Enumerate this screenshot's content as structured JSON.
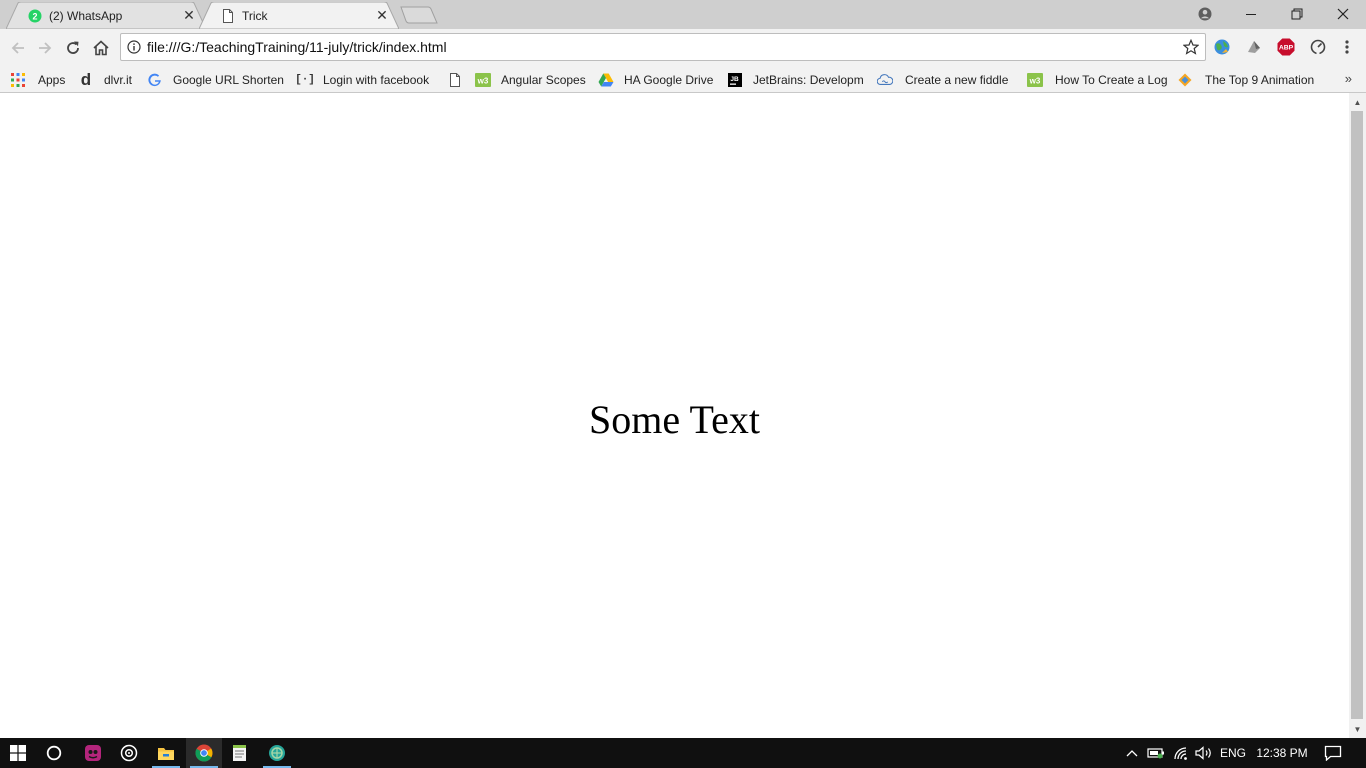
{
  "tabs": [
    {
      "title": "(2) WhatsApp",
      "badge": "2",
      "icon": "whatsapp-icon",
      "active": false
    },
    {
      "title": "Trick",
      "icon": "page-icon",
      "active": true
    }
  ],
  "toolbar": {
    "url": "file:///G:/TeachingTraining/11-july/trick/index.html"
  },
  "bookmarks": [
    {
      "label": "Apps",
      "icon": "apps-grid-icon"
    },
    {
      "label": "dlvr.it",
      "icon": "dlvrit-icon"
    },
    {
      "label": "Google URL Shorten",
      "icon": "google-icon"
    },
    {
      "label": "Login with facebook",
      "icon": "bracket-icon"
    },
    {
      "label": "",
      "icon": "page-icon"
    },
    {
      "label": "Angular Scopes",
      "icon": "w3schools-icon"
    },
    {
      "label": "HA Google Drive",
      "icon": "google-drive-icon"
    },
    {
      "label": "JetBrains: Developm",
      "icon": "jetbrains-icon"
    },
    {
      "label": "Create a new fiddle",
      "icon": "jsfiddle-icon"
    },
    {
      "label": "How To Create a Log",
      "icon": "w3schools-icon"
    },
    {
      "label": "The Top 9 Animation",
      "icon": "diamond-icon"
    }
  ],
  "page": {
    "text": "Some Text"
  },
  "taskbar": {
    "language": "ENG",
    "time": "12:38 PM"
  },
  "colors": {
    "whatsapp": "#25d366",
    "abp": "#c70d2c",
    "w3schools": "#8bc34a",
    "taskbar": "#101010"
  }
}
